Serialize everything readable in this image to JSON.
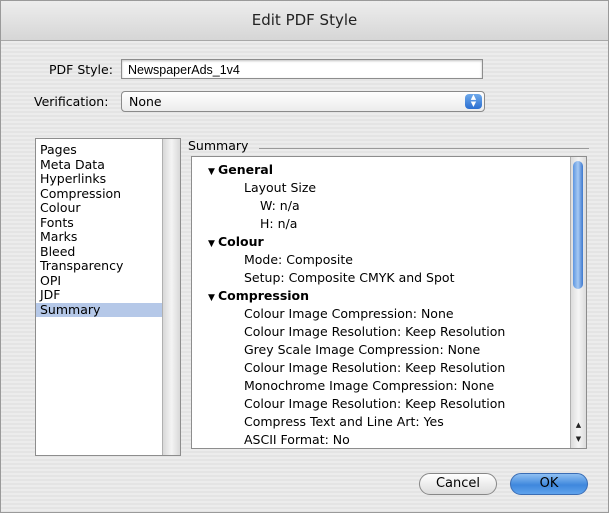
{
  "window": {
    "title": "Edit PDF Style"
  },
  "form": {
    "pdf_style_label": "PDF Style:",
    "pdf_style_value": "NewspaperAds_1v4",
    "verification_label": "Verification:",
    "verification_value": "None"
  },
  "sidebar": {
    "items": [
      {
        "label": "Pages"
      },
      {
        "label": "Meta Data"
      },
      {
        "label": "Hyperlinks"
      },
      {
        "label": "Compression"
      },
      {
        "label": "Colour"
      },
      {
        "label": "Fonts"
      },
      {
        "label": "Marks"
      },
      {
        "label": "Bleed"
      },
      {
        "label": "Transparency"
      },
      {
        "label": "OPI"
      },
      {
        "label": "JDF"
      },
      {
        "label": "Summary"
      }
    ],
    "selected": "Summary"
  },
  "summary": {
    "group_label": "Summary",
    "lines": [
      {
        "text": "General",
        "level": 0,
        "heading": true
      },
      {
        "text": "Layout Size",
        "level": 1,
        "heading": false
      },
      {
        "text": "W: n/a",
        "level": 2,
        "heading": false
      },
      {
        "text": "H: n/a",
        "level": 2,
        "heading": false
      },
      {
        "text": "Colour",
        "level": 0,
        "heading": true
      },
      {
        "text": "Mode: Composite",
        "level": 1,
        "heading": false
      },
      {
        "text": "Setup: Composite CMYK and Spot",
        "level": 1,
        "heading": false
      },
      {
        "text": "Compression",
        "level": 0,
        "heading": true
      },
      {
        "text": "Colour Image Compression: None",
        "level": 1,
        "heading": false
      },
      {
        "text": "Colour Image Resolution: Keep Resolution",
        "level": 1,
        "heading": false
      },
      {
        "text": "Grey Scale Image Compression: None",
        "level": 1,
        "heading": false
      },
      {
        "text": "Colour Image Resolution: Keep Resolution",
        "level": 1,
        "heading": false
      },
      {
        "text": "Monochrome Image Compression: None",
        "level": 1,
        "heading": false
      },
      {
        "text": "Colour Image Resolution: Keep Resolution",
        "level": 1,
        "heading": false
      },
      {
        "text": "Compress Text and Line Art: Yes",
        "level": 1,
        "heading": false
      },
      {
        "text": "ASCII Format: No",
        "level": 1,
        "heading": false
      }
    ]
  },
  "buttons": {
    "cancel": "Cancel",
    "ok": "OK"
  }
}
